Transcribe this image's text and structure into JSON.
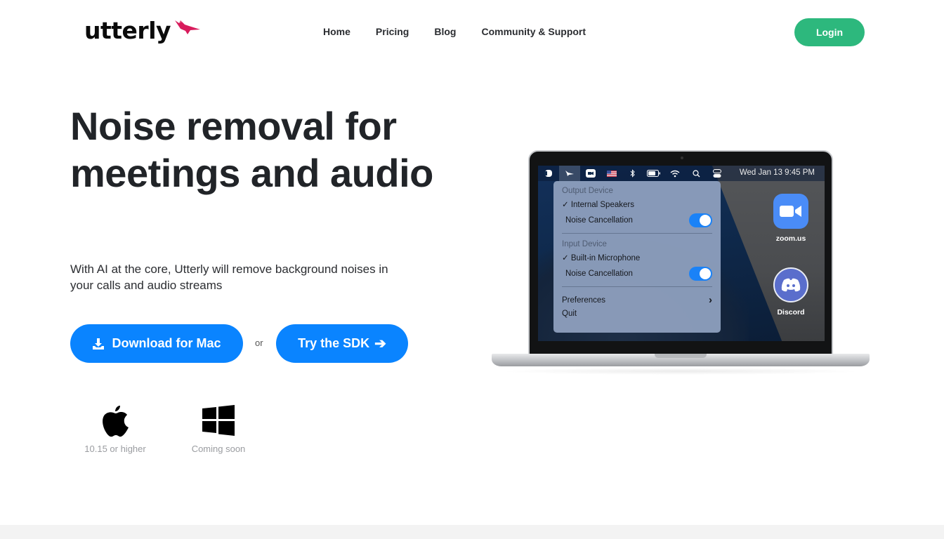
{
  "header": {
    "logo_text": "utterly",
    "nav": [
      "Home",
      "Pricing",
      "Blog",
      "Community & Support"
    ],
    "login_label": "Login"
  },
  "hero": {
    "title": "Noise removal for meetings and audio",
    "subtitle": "With AI at the core, Utterly will remove background noises in your calls and audio streams",
    "download_label": "Download for Mac",
    "or_text": "or",
    "sdk_label": "Try the SDK",
    "sdk_arrow": "➔",
    "platforms": [
      {
        "name": "apple",
        "caption": "10.15 or higher"
      },
      {
        "name": "windows",
        "caption": "Coming soon"
      }
    ]
  },
  "laptop": {
    "clock": "Wed Jan 13  9:45 PM",
    "menu": {
      "output_header": "Output Device",
      "output_device": "✓ Internal Speakers",
      "output_nc_label": "Noise Cancellation",
      "output_nc_on": true,
      "input_header": "Input Device",
      "input_device": "✓ Built-in Microphone",
      "input_nc_label": "Noise Cancellation",
      "input_nc_on": true,
      "preferences": "Preferences",
      "preferences_chevron": "›",
      "quit": "Quit"
    },
    "desktop_icons": [
      "zoom.us",
      "Discord"
    ]
  },
  "colors": {
    "login_green": "#2db87d",
    "primary_blue": "#0a84ff",
    "logo_bird": "#d81b5c"
  }
}
